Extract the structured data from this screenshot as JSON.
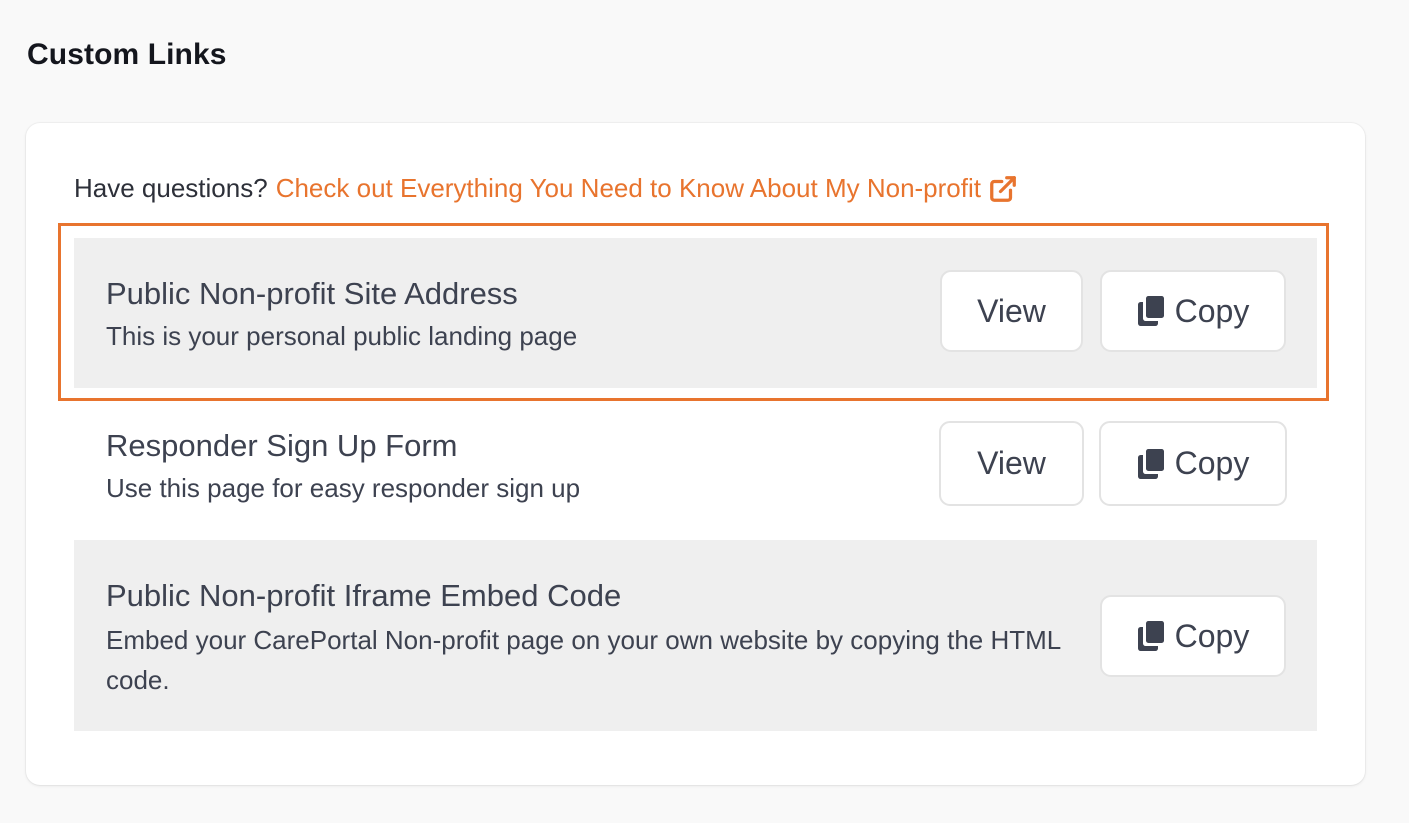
{
  "page": {
    "title": "Custom Links"
  },
  "help": {
    "prefix": "Have questions?",
    "link_text": "Check out Everything You Need to Know About My Non-profit",
    "link_icon": "external-link-icon"
  },
  "links": [
    {
      "title": "Public Non-profit Site Address",
      "description": "This is your personal public landing page",
      "view_label": "View",
      "copy_label": "Copy",
      "highlighted": true
    },
    {
      "title": "Responder Sign Up Form",
      "description": "Use this page for easy responder sign up",
      "view_label": "View",
      "copy_label": "Copy",
      "highlighted": false
    },
    {
      "title": "Public Non-profit Iframe Embed Code",
      "description": "Embed your CarePortal Non-profit page on your own website by copying the HTML code.",
      "copy_label": "Copy",
      "highlighted": false
    }
  ],
  "colors": {
    "accent": "#e8742e",
    "row_shade": "#efefef",
    "text": "#3d4250",
    "heading": "#14161d"
  }
}
